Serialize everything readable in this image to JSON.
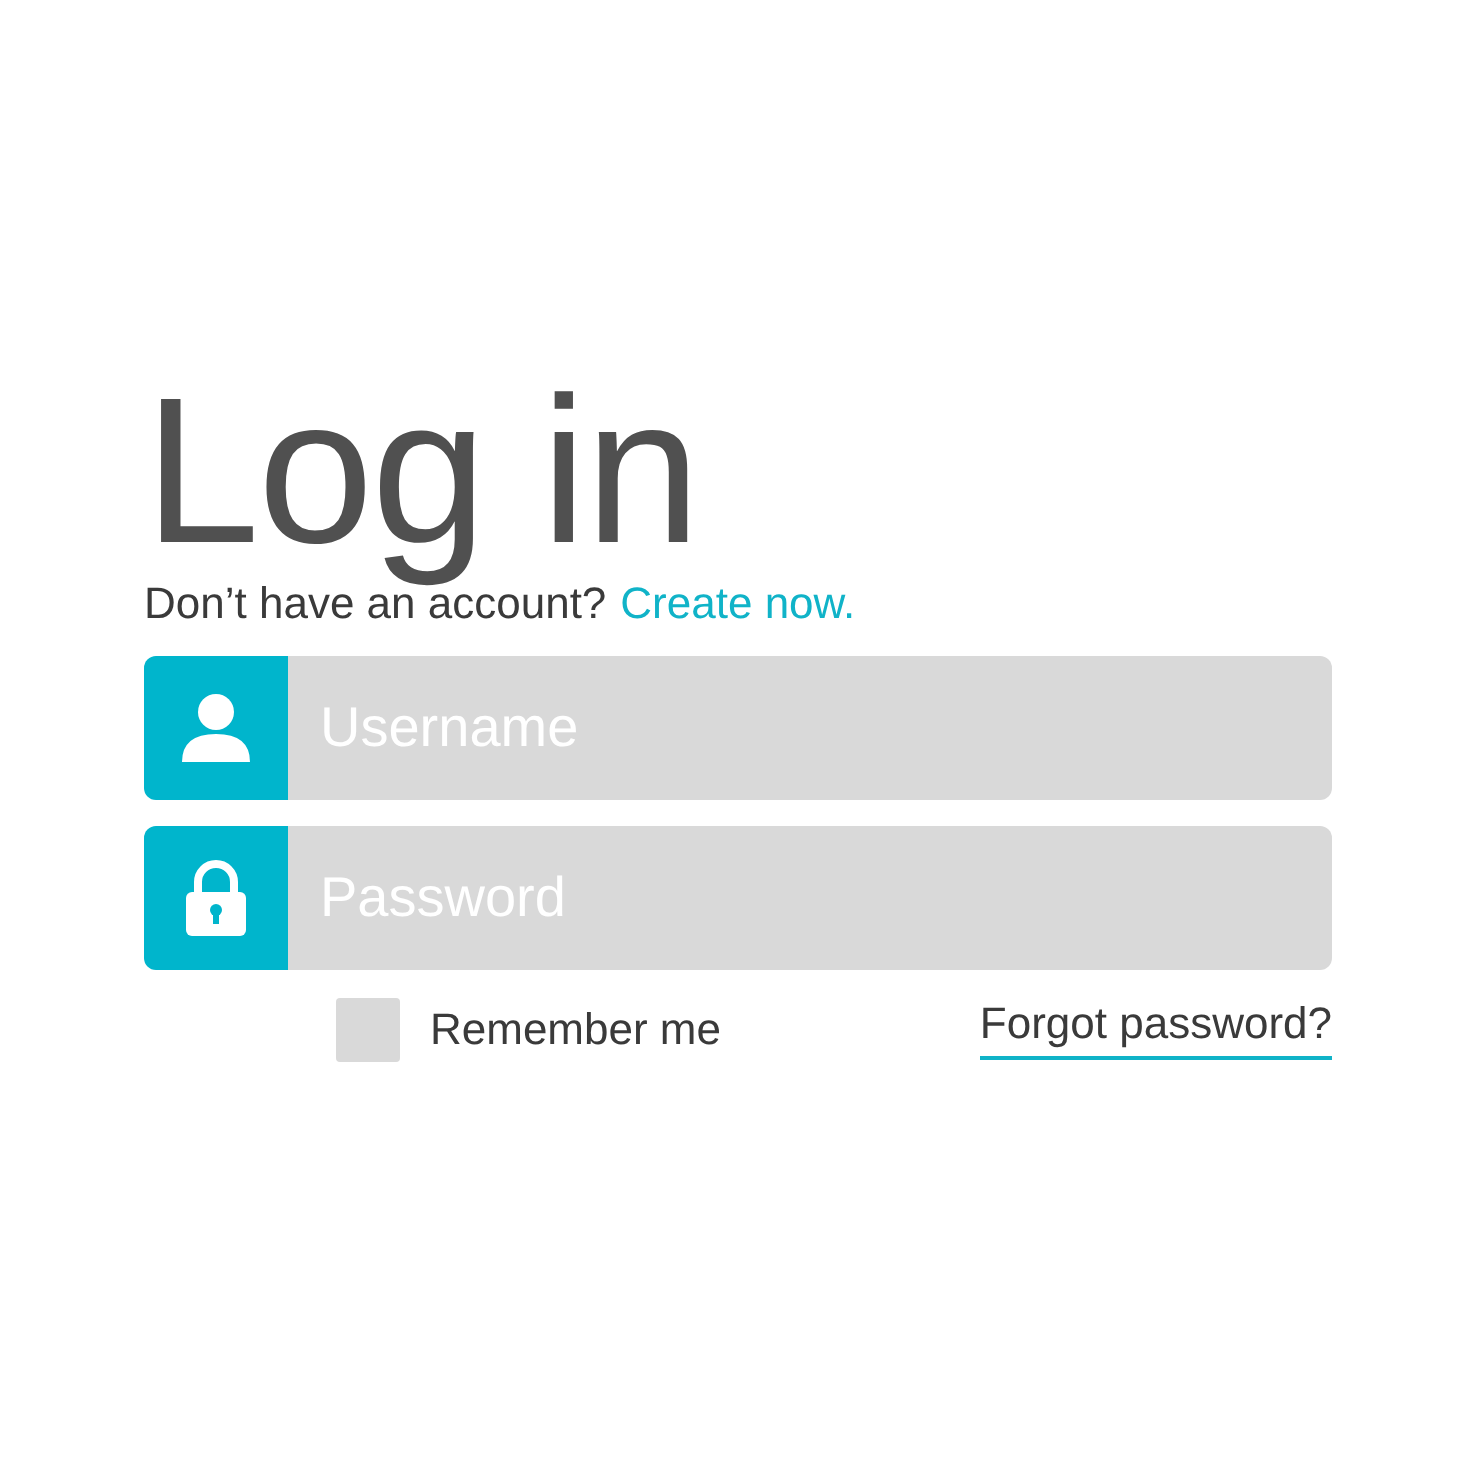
{
  "title": "Log in",
  "signup_prompt": {
    "text": "Don’t have an account?",
    "link": "Create now."
  },
  "fields": [
    {
      "kind": "username",
      "placeholder": "Username"
    },
    {
      "kind": "password",
      "placeholder": "Password"
    }
  ],
  "remember_me": {
    "label": "Remember me",
    "checked": false
  },
  "forgot_link": "Forgot password?"
}
